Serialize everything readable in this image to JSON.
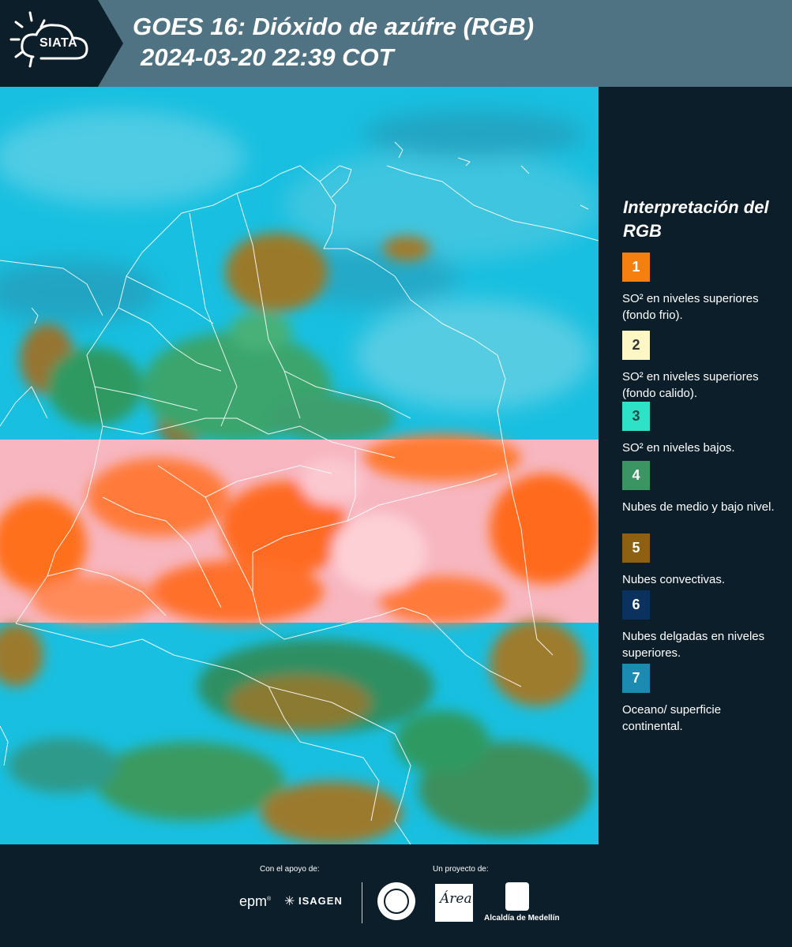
{
  "header": {
    "logo_text": "SIATA",
    "title_line1": "GOES 16: Dióxido de azúfre (RGB)",
    "title_line2": "2024-03-20 22:39 COT"
  },
  "legend": {
    "title": "Interpretación del RGB",
    "items": [
      {
        "number": "1",
        "label": "SO² en niveles superiores (fondo frio).",
        "color": "#f5800f",
        "text_color": "#ffffff"
      },
      {
        "number": "2",
        "label": "SO² en niveles superiores (fondo calido).",
        "color": "#fdf7c6",
        "text_color": "#333333"
      },
      {
        "number": "3",
        "label": "SO² en niveles bajos.",
        "color": "#2de2c6",
        "text_color": "#1d4d4a"
      },
      {
        "number": "4",
        "label": "Nubes de medio y bajo nivel.",
        "color": "#3b9563",
        "text_color": "#ffffff"
      },
      {
        "number": "5",
        "label": "Nubes convectivas.",
        "color": "#8e6012",
        "text_color": "#ffffff"
      },
      {
        "number": "6",
        "label": "Nubes delgadas en niveles superiores.",
        "color": "#0b315f",
        "text_color": "#ffffff"
      },
      {
        "number": "7",
        "label": "Oceano/ superficie continental.",
        "color": "#1c8bb1",
        "text_color": "#ffffff"
      }
    ]
  },
  "footer": {
    "support_label": "Con el apoyo de:",
    "project_label": "Un proyecto de:",
    "epm": "epm",
    "isagen": "ISAGEN",
    "area_logo": "Área",
    "alcaldia": "Alcaldía de Medellín"
  },
  "colors": {
    "background": "#0d1e2b",
    "header_band": "#4f7382",
    "map_ocean": "#18bfe0",
    "map_pink_band": "#f7b6c0",
    "map_orange": "#ff6f1c",
    "map_green": "#2e8f62",
    "map_brown": "#9b7a2e"
  }
}
